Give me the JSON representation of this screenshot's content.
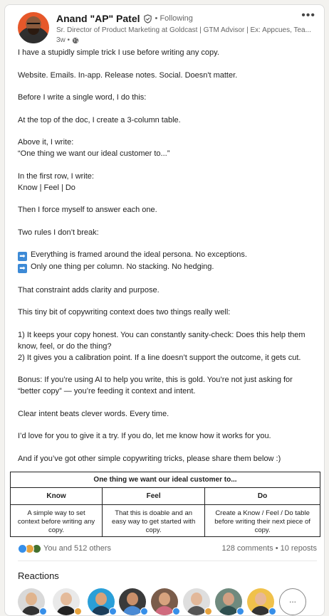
{
  "author": {
    "name": "Anand \"AP\" Patel",
    "following": "• Following",
    "headline": "Sr. Director of Product Marketing at Goldcast | GTM Advisor | Ex: Appcues, Tea...",
    "time": "3w •"
  },
  "post": {
    "p1": "I have a stupidly simple trick I use before writing any copy.",
    "p2": "Website. Emails. In-app. Release notes. Social. Doesn't matter.",
    "p3": "Before I write a single word, I do this:",
    "p4": "At the top of the doc, I create a 3-column table.",
    "p5a": "Above it, I write:",
    "p5b": "“One thing we want our ideal customer to...”",
    "p6a": "In the first row, I write:",
    "p6b": "Know | Feel | Do",
    "p7": "Then I force myself to answer each one.",
    "p8": "Two rules I don’t break:",
    "rule1": "Everything is framed around the ideal persona. No exceptions.",
    "rule2": "Only one thing per column. No stacking. No hedging.",
    "p9": "That constraint adds clarity and purpose.",
    "p10": "This tiny bit of copywriting context does two things really well:",
    "p11a": "1) It keeps your copy honest. You can constantly sanity-check: Does this help them",
    "p11b": "know, feel, or do the thing?",
    "p11c": "2) It gives you a calibration point. If a line doesn’t support the outcome, it gets cut.",
    "p12a": "Bonus: If you’re using AI to help you write, this is gold. You’re not just asking for",
    "p12b": "“better copy” — you’re feeding it context and intent.",
    "p13": "Clear intent beats clever words. Every time.",
    "p14": "I’d love for you to give it a try. If you do, let me know how it works for you.",
    "p15": "And if you’ve got other simple copywriting tricks, please share them below :)",
    "arrow_glyph": "➡"
  },
  "table": {
    "title": "One thing we want our ideal customer to...",
    "headers": [
      "Know",
      "Feel",
      "Do"
    ],
    "cells": [
      "A simple way to set context before writing any copy.",
      "That this is doable and an easy way to get started with copy.",
      "Create a Know / Feel / Do table before writing their next piece of copy."
    ]
  },
  "social": {
    "reactions": "You and 512 others",
    "comments_reposts": "128 comments • 10 reposts"
  },
  "reactions_section": {
    "heading": "Reactions",
    "more": "..."
  },
  "icons": {
    "verified": "verified-shield-icon",
    "globe": "globe-icon",
    "more": "more-options-icon",
    "like": "like-icon",
    "celebrate": "celebrate-icon",
    "support": "support-icon"
  },
  "colors": {
    "like": "#378fe9",
    "celebrate": "#e7a33e",
    "support": "#44712e",
    "arrow": "#3d8ad6"
  }
}
